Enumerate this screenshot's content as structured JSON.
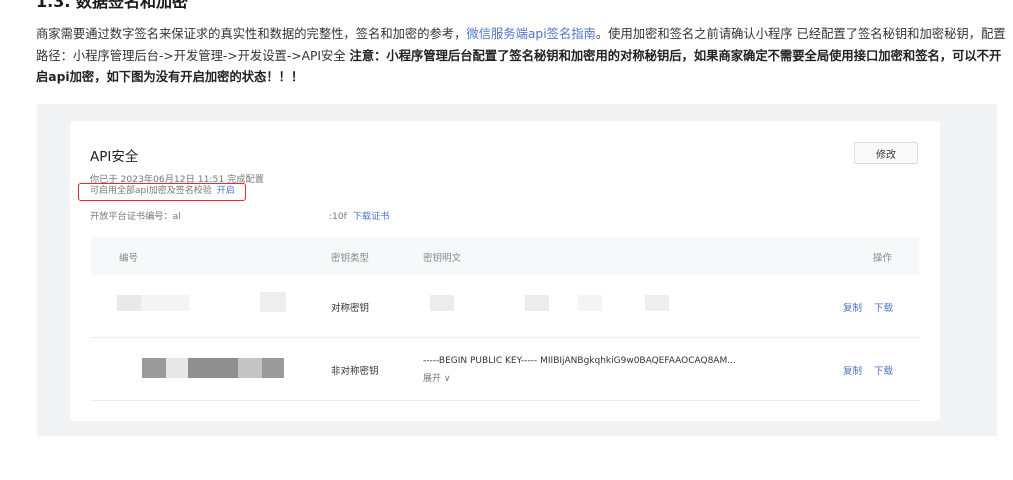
{
  "article": {
    "heading": "1.3. 数据签名和加密",
    "intro_text": "商家需要通过数字签名来保证求的真实性和数据的完整性，签名和加密的参考，",
    "intro_link": "微信服务端api签名指南",
    "intro_text2": "。使用加密和签名之前请确认小程序 已经配置了签名秘钥和加密秘钥，配置路径：小程序管理后台->开发管理->开发设置->API安全 ",
    "intro_note": "注意：小程序管理后台配置了签名秘钥和加密用的对称秘钥后，如果商家确定不需要全局使用接口加密和签名，可以不开启api加密，如下图为没有开启加密的状态！！！"
  },
  "api_panel": {
    "title": "API安全",
    "edit_label": "修改",
    "config_time": "你已于 2023年06月12日 11:51 完成配置",
    "enable_text": "可启用全部api加密及签名校验",
    "enable_link": "开启",
    "cert_prefix": "开放平台证书编号：al",
    "cert_suffix": ":10f",
    "cert_link": "下载证书",
    "columns": {
      "id": "编号",
      "key_type": "密钥类型",
      "key_plain": "密钥明文",
      "actions": "操作"
    },
    "rows": [
      {
        "key_type": "对称密钥",
        "key_plain": "",
        "expand": "",
        "copy": "复制",
        "download": "下载"
      },
      {
        "key_type": "非对称密钥",
        "key_plain": "-----BEGIN PUBLIC KEY----- MIIBIjANBgkqhkiG9w0BAQEFAAOCAQ8AM...",
        "expand": "展开 ∨",
        "copy": "复制",
        "download": "下载"
      }
    ]
  },
  "colors": {
    "link": "#4c74c9",
    "highlight_border": "#e22d2d",
    "background": "#f2f3f5"
  }
}
